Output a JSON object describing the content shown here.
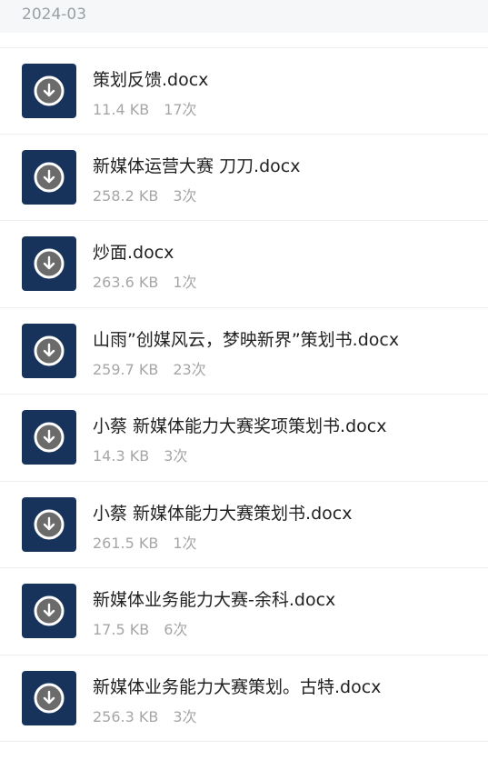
{
  "header": {
    "date": "2024-03"
  },
  "files": [
    {
      "name": "策划反馈.docx",
      "size": "11.4 KB",
      "count": "17次",
      "icon": "download-icon"
    },
    {
      "name": "新媒体运营大赛 刀刀.docx",
      "size": "258.2 KB",
      "count": "3次",
      "icon": "download-icon"
    },
    {
      "name": "炒面.docx",
      "size": "263.6 KB",
      "count": "1次",
      "icon": "download-icon"
    },
    {
      "name": "山雨”创媒风云，梦映新界”策划书.docx",
      "size": "259.7 KB",
      "count": "23次",
      "icon": "download-icon"
    },
    {
      "name": "小蔡 新媒体能力大赛奖项策划书.docx",
      "size": "14.3 KB",
      "count": "3次",
      "icon": "download-icon"
    },
    {
      "name": "小蔡 新媒体能力大赛策划书.docx",
      "size": "261.5 KB",
      "count": "1次",
      "icon": "download-icon"
    },
    {
      "name": "新媒体业务能力大赛-余科.docx",
      "size": "17.5 KB",
      "count": "6次",
      "icon": "download-icon"
    },
    {
      "name": "新媒体业务能力大赛策划。古特.docx",
      "size": "256.3 KB",
      "count": "3次",
      "icon": "download-icon"
    }
  ],
  "colors": {
    "thumb_bg": "#17335c",
    "icon_disc": "#6b6b6b",
    "header_bg": "#f6f7f9"
  }
}
